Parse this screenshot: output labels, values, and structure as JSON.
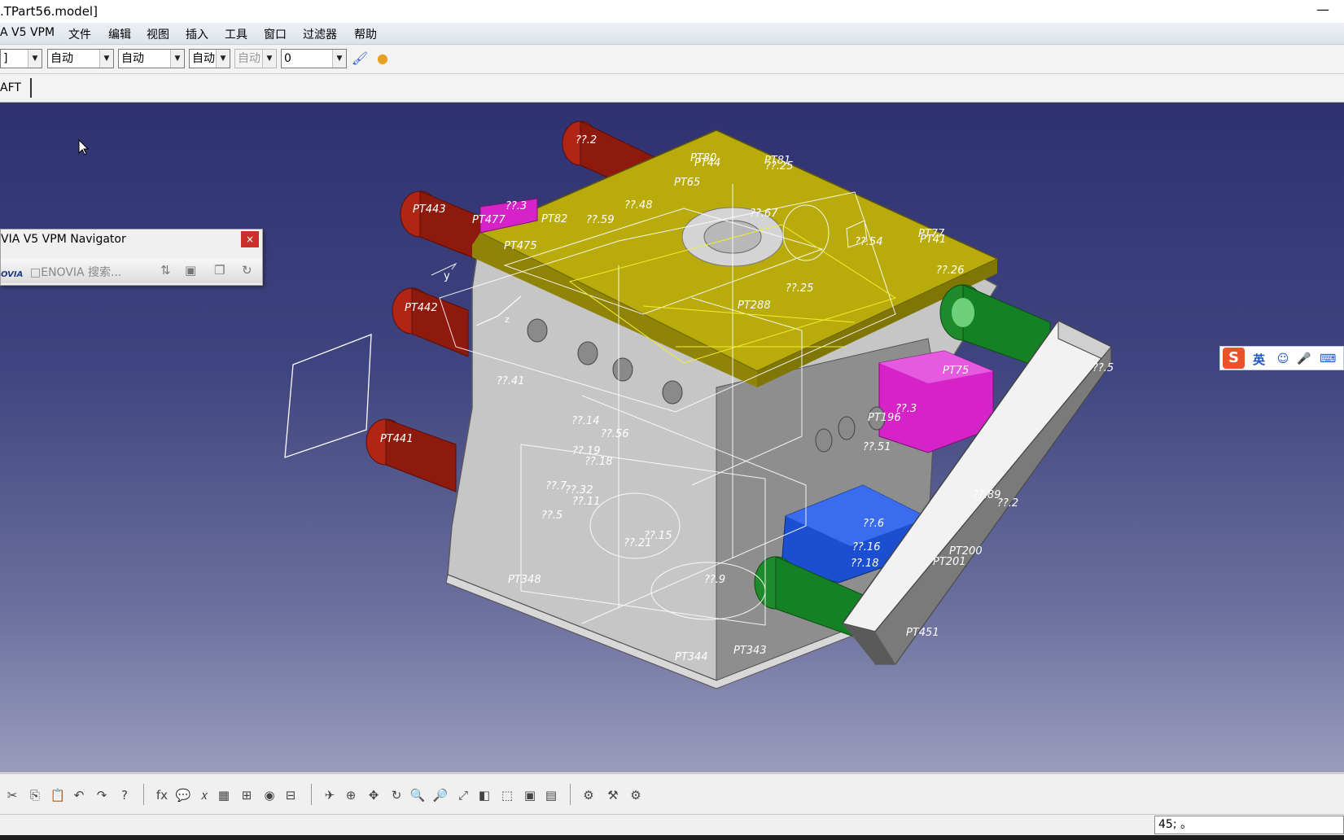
{
  "window": {
    "title": ".TPart56.model]",
    "minimize_glyph": "—"
  },
  "menu": [
    "A V5 VPM",
    "文件",
    "编辑",
    "视图",
    "插入",
    "工具",
    "窗口",
    "过滤器",
    "帮助"
  ],
  "toolbar": {
    "combos": [
      "]",
      "自动",
      "自动",
      "自动",
      "自动",
      "0"
    ],
    "brush_icon": "paintbrush-icon",
    "brush_glyph": "🖌",
    "palette_icon": "color-palette-icon",
    "palette_glyph": "●"
  },
  "workbench": {
    "label": "AFT"
  },
  "navigator": {
    "title": "VIA V5 VPM Navigator",
    "close_glyph": "×",
    "logo": "OVIA",
    "search_label": "□ENOVIA 搜索..."
  },
  "viewport": {
    "cad_labels": [
      "??.2",
      "PT80",
      "PT44",
      "PT81",
      "??.25",
      "PT65",
      "??.48",
      "??.67",
      "PT443",
      "??.3",
      "PT477",
      "PT82",
      "??.59",
      "PT475",
      "??.54",
      "PT77",
      "PT41",
      "??.26",
      "PT288",
      "??.25",
      "PT442",
      "??.41",
      "??.14",
      "??.56",
      "??.19",
      "??.18",
      "??.15",
      "??.5",
      "PT441",
      "??.7",
      "??.32",
      "??.11",
      "??.21",
      "??.9",
      "??.3",
      "??.51",
      "??.6",
      "??.16",
      "??.18",
      "PT200",
      "PT201",
      "PT451",
      "PT344",
      "PT343",
      "PT348",
      "??.5",
      "??.2",
      "??.89",
      "PT196",
      "PT75"
    ],
    "axis_y": "y",
    "axis_z": "z"
  },
  "ime": {
    "logo": "S",
    "lang": "英",
    "emoji_icon": "smile-icon",
    "emoji_glyph": "☺",
    "mic_icon": "microphone-icon",
    "mic_glyph": "🎤",
    "keyboard_icon": "keyboard-icon",
    "keyboard_glyph": "⌨"
  },
  "bottom_toolbar": [
    "✂",
    "⎘",
    "📋",
    "↶",
    "↷",
    "?",
    "fx",
    "💬",
    "𝑥",
    "▦",
    "⊞",
    "◉",
    "⊟",
    "✈",
    "⊕",
    "✥",
    "↻",
    "🔍",
    "🔎",
    "⤢",
    "◧",
    "⬚",
    "▣",
    "▤",
    "⚙",
    "⚒",
    "⚙"
  ],
  "status": {
    "command": "45; 。"
  }
}
